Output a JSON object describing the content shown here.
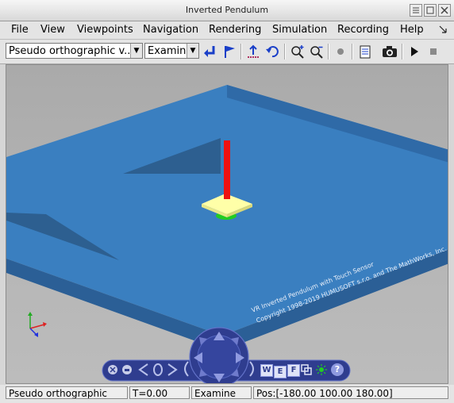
{
  "window": {
    "title": "Inverted Pendulum"
  },
  "menu": {
    "file": "File",
    "view": "View",
    "viewpoints": "Viewpoints",
    "navigation": "Navigation",
    "rendering": "Rendering",
    "simulation": "Simulation",
    "recording": "Recording",
    "help": "Help"
  },
  "toolbar": {
    "viewpoint_select": "Pseudo orthographic v...",
    "nav_mode_select": "Examine"
  },
  "scene": {
    "floor_text_line1": "VR Inverted Pendulum with Touch Sensor",
    "floor_text_line2": "Copyright 1998-2019 HUMUSOFT s.r.o. and The MathWorks, Inc."
  },
  "nav_panel": {
    "w_label": "W",
    "e_label": "E",
    "f_label": "F",
    "help_label": "?"
  },
  "status": {
    "viewpoint": "Pseudo orthographic",
    "time": "T=0.00",
    "mode": "Examine",
    "position": "Pos:[-180.00 100.00 180.00]"
  },
  "colors": {
    "floor": "#3a7fc0",
    "pendulum": "#ee1111",
    "cart": "#ffffa0",
    "nav_panel": "#2f3d8f"
  }
}
